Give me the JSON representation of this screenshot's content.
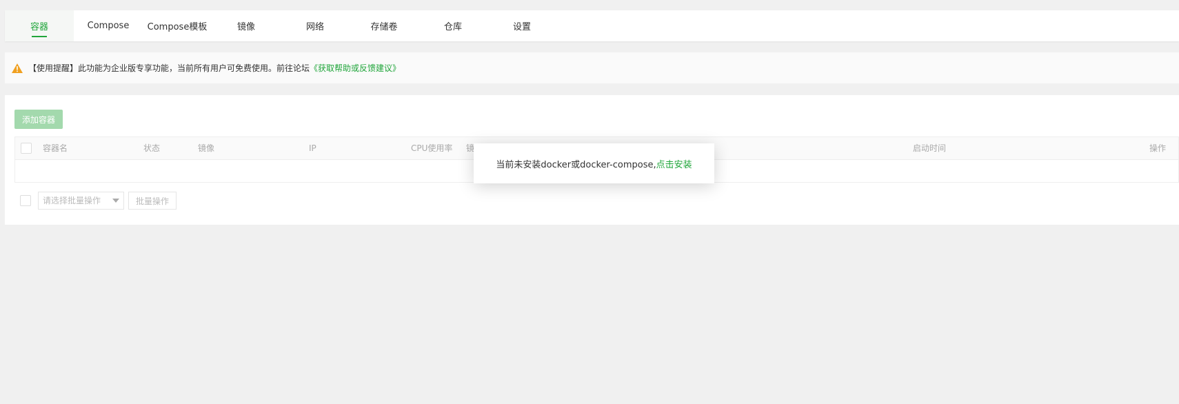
{
  "tabs": [
    {
      "label": "容器",
      "active": true
    },
    {
      "label": "Compose",
      "active": false
    },
    {
      "label": "Compose模板",
      "active": false
    },
    {
      "label": "镜像",
      "active": false
    },
    {
      "label": "网络",
      "active": false
    },
    {
      "label": "存储卷",
      "active": false
    },
    {
      "label": "仓库",
      "active": false
    },
    {
      "label": "设置",
      "active": false
    }
  ],
  "notice": {
    "icon": "warning-icon",
    "text": "【使用提醒】此功能为企业版专享功能，当前所有用户可免费使用。前往论坛",
    "link": "《获取帮助或反馈建议》"
  },
  "toolbar": {
    "add_label": "添加容器"
  },
  "table": {
    "columns": [
      "容器名",
      "状态",
      "镜像",
      "IP",
      "CPU使用率",
      "镜",
      "启动时间",
      "操作"
    ]
  },
  "batch": {
    "select_placeholder": "请选择批量操作",
    "batch_label": "批量操作"
  },
  "modal": {
    "message": "当前未安装docker或docker-compose,",
    "link": "点击安装"
  },
  "colors": {
    "accent": "#20a53a",
    "warning": "#f0a020"
  }
}
